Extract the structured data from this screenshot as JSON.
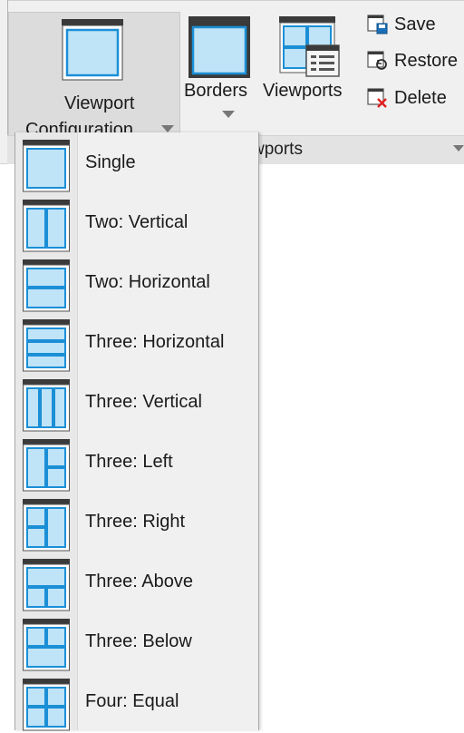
{
  "ribbon": {
    "viewport_configuration": {
      "line1": "Viewport",
      "line2": "Configuration"
    },
    "borders_label": "Borders",
    "viewports_label": "Viewports",
    "save_label": "Save",
    "restore_label": "Restore",
    "delete_label": "Delete",
    "panel_title": "wports"
  },
  "dropdown": {
    "items": [
      {
        "label": "Single",
        "icon": "single-viewport-icon"
      },
      {
        "label": "Two: Vertical",
        "icon": "two-vertical-icon"
      },
      {
        "label": "Two: Horizontal",
        "icon": "two-horizontal-icon"
      },
      {
        "label": "Three: Horizontal",
        "icon": "three-horizontal-icon"
      },
      {
        "label": "Three: Vertical",
        "icon": "three-vertical-icon"
      },
      {
        "label": "Three: Left",
        "icon": "three-left-icon"
      },
      {
        "label": "Three: Right",
        "icon": "three-right-icon"
      },
      {
        "label": "Three: Above",
        "icon": "three-above-icon"
      },
      {
        "label": "Three: Below",
        "icon": "three-below-icon"
      },
      {
        "label": "Four: Equal",
        "icon": "four-equal-icon"
      }
    ]
  },
  "colors": {
    "viewport_fill": "#bfe3f7",
    "viewport_stroke": "#1b8fd6",
    "icon_header": "#3a3a3a"
  }
}
